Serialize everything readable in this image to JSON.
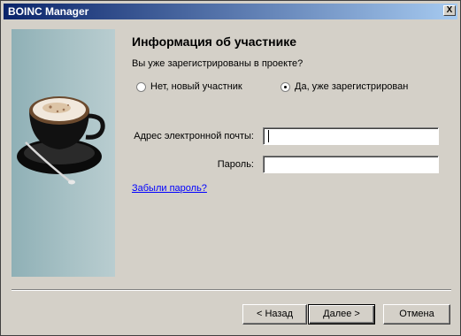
{
  "window": {
    "title": "BOINC Manager",
    "close_label": "X"
  },
  "page": {
    "heading": "Информация об участнике",
    "question": "Вы уже зарегистрированы в проекте?",
    "radio_new_label": "Нет, новый участник",
    "radio_existing_label": "Да, уже зарегистрирован",
    "selected_option": "existing"
  },
  "form": {
    "email_label": "Адрес электронной почты:",
    "email_value": "",
    "password_label": "Пароль:",
    "password_value": ""
  },
  "forgot_link": "Забыли пароль?",
  "buttons": {
    "back": "< Назад",
    "next": "Далее >",
    "cancel": "Отмена"
  }
}
